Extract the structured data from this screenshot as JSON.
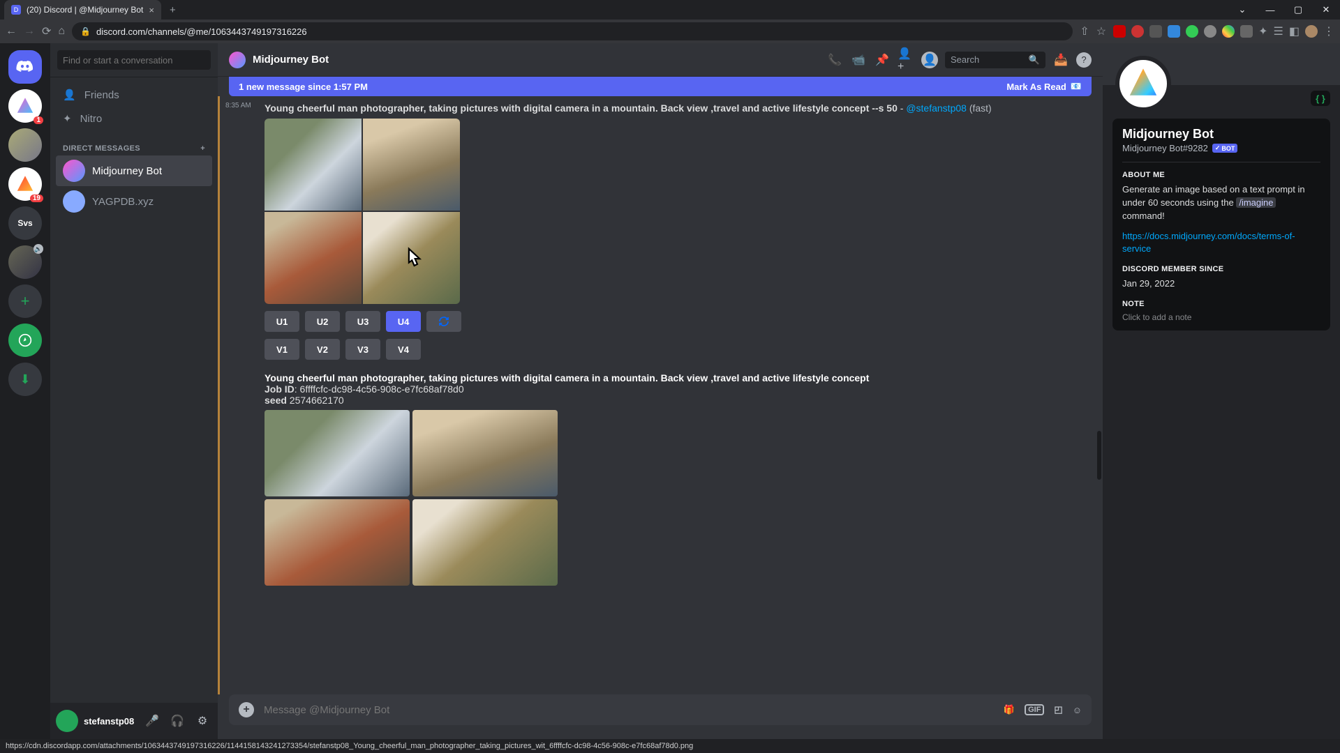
{
  "browser": {
    "tab_title": "(20) Discord | @Midjourney Bot",
    "url": "discord.com/channels/@me/1063443749197316226",
    "new_tab": "+",
    "chevron": "⌄",
    "status_url": "https://cdn.discordapp.com/attachments/1063443749197316226/1144158143241273354/stefanstp08_Young_cheerful_man_photographer_taking_pictures_wit_6ffffcfc-dc98-4c56-908c-e7fc68af78d0.png"
  },
  "dm": {
    "search_placeholder": "Find or start a conversation",
    "friends": "Friends",
    "nitro": "Nitro",
    "header": "DIRECT MESSAGES",
    "plus": "+",
    "items": [
      {
        "name": "Midjourney Bot"
      },
      {
        "name": "YAGPDB.xyz"
      }
    ]
  },
  "servers": {
    "badge1": "1",
    "badge2": "19",
    "svs": "Svs"
  },
  "header": {
    "title": "Midjourney Bot",
    "search": "Search"
  },
  "banner": {
    "text": "1 new message since 1:57 PM",
    "mark": "Mark As Read"
  },
  "msg1": {
    "time": "8:35 AM",
    "prompt": "Young cheerful man photographer, taking pictures with digital camera in a mountain. Back view ,travel and active lifestyle concept --s 50",
    "dash": " - ",
    "mention": "@stefanstp08",
    "fast": " (fast)",
    "buttons_u": [
      "U1",
      "U2",
      "U3",
      "U4"
    ],
    "reroll": "🔄",
    "buttons_v": [
      "V1",
      "V2",
      "V3",
      "V4"
    ]
  },
  "msg2": {
    "prompt": "Young cheerful man photographer, taking pictures with digital camera in a mountain. Back view ,travel and active lifestyle concept",
    "job_label": "Job ID",
    "job_id": ": 6ffffcfc-dc98-4c56-908c-e7fc68af78d0",
    "seed_label": "seed",
    "seed": " 2574662170"
  },
  "input": {
    "placeholder": "Message @Midjourney Bot",
    "gif": "GIF"
  },
  "user": {
    "name": "stefanstp08"
  },
  "profile": {
    "name": "Midjourney Bot",
    "tag": "Midjourney Bot#9282",
    "bot": "BOT",
    "dev": "{ }",
    "about_h": "ABOUT ME",
    "about_1": "Generate an image based on a text prompt in under 60 seconds using the ",
    "about_cmd": "/imagine",
    "about_2": " command!",
    "link": "https://docs.midjourney.com/docs/terms-of-service",
    "member_h": "DISCORD MEMBER SINCE",
    "member_date": "Jan 29, 2022",
    "note_h": "NOTE",
    "note_ph": "Click to add a note"
  }
}
